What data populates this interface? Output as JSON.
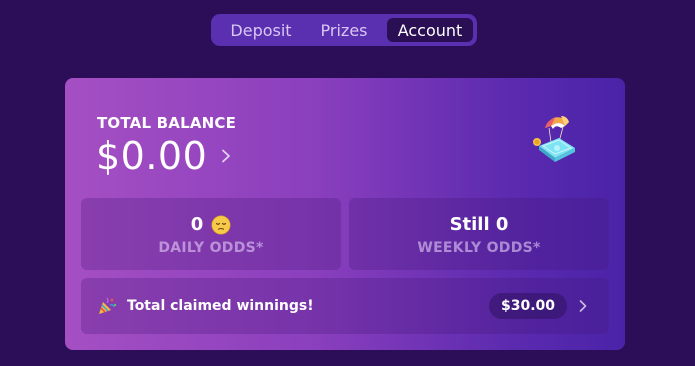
{
  "tabs": [
    {
      "label": "Deposit",
      "active": false
    },
    {
      "label": "Prizes",
      "active": false
    },
    {
      "label": "Account",
      "active": true
    }
  ],
  "balance": {
    "label": "TOTAL BALANCE",
    "value": "$0.00",
    "icon": "chevron-right-icon"
  },
  "illustration": {
    "icon": "money-parachute-icon"
  },
  "daily_odds": {
    "value": "0",
    "emoji": "pensive-face-icon",
    "label": "DAILY ODDS*"
  },
  "weekly_odds": {
    "value": "Still 0",
    "label": "WEEKLY ODDS*"
  },
  "winnings": {
    "icon": "party-popper-icon",
    "label": "Total claimed winnings!",
    "amount": "$30.00",
    "chevron": "chevron-right-icon"
  },
  "colors": {
    "background": "#2c0d57",
    "tab_bar": "#5a2fb0",
    "tab_active": "#2a0f55",
    "card_gradient_start": "#a54fc3",
    "card_gradient_end": "#4a23a8"
  }
}
